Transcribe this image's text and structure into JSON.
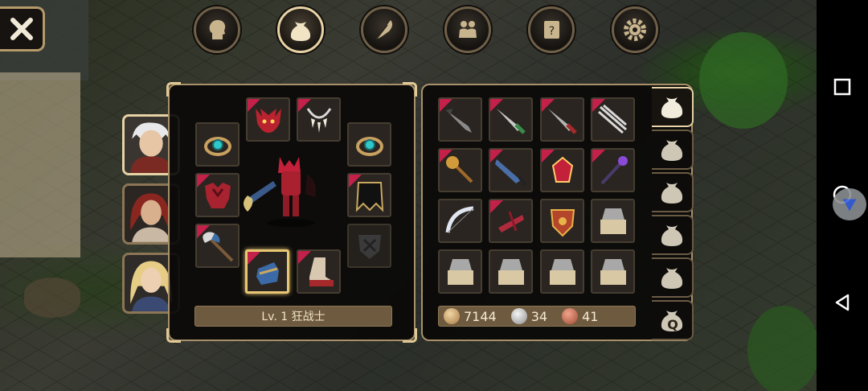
{
  "top_tabs": [
    {
      "name": "character",
      "icon": "head-icon",
      "active": false
    },
    {
      "name": "inventory",
      "icon": "bag-icon",
      "active": true
    },
    {
      "name": "skills",
      "icon": "feather-icon",
      "active": false
    },
    {
      "name": "party",
      "icon": "people-icon",
      "active": false
    },
    {
      "name": "quests",
      "icon": "scroll-icon",
      "active": false
    },
    {
      "name": "settings",
      "icon": "gear-icon",
      "active": false
    }
  ],
  "character": {
    "level_label": "Lv. 1 狂战士"
  },
  "portraits": [
    {
      "name": "white-haired-hero",
      "active": true
    },
    {
      "name": "red-haired-warrior",
      "active": false
    },
    {
      "name": "blonde-elf",
      "active": false
    }
  ],
  "equipment": [
    {
      "slot": "helmet",
      "item": "red-dragon-helm-icon",
      "new": true
    },
    {
      "slot": "necklace",
      "item": "fang-necklace-icon",
      "new": true
    },
    {
      "slot": "ring-left",
      "item": "teal-ring-icon",
      "new": false
    },
    {
      "slot": "ring-right",
      "item": "teal-ring-icon",
      "new": false
    },
    {
      "slot": "armor",
      "item": "red-dragon-armor-icon",
      "new": true
    },
    {
      "slot": "cape",
      "item": "black-cape-icon",
      "new": true
    },
    {
      "slot": "weapon",
      "item": "double-axe-icon",
      "new": true
    },
    {
      "slot": "offhand",
      "item": "shield-placeholder-icon",
      "new": false
    },
    {
      "slot": "gloves",
      "item": "blue-gauntlet-icon",
      "new": true,
      "selected": true
    },
    {
      "slot": "boots",
      "item": "red-boot-icon",
      "new": true
    }
  ],
  "inventory": [
    {
      "item": "dark-dagger-icon",
      "new": true
    },
    {
      "item": "green-sword-icon",
      "new": true
    },
    {
      "item": "red-sword-icon",
      "new": true
    },
    {
      "item": "claw-blade-icon",
      "new": true
    },
    {
      "item": "golden-mace-icon",
      "new": true
    },
    {
      "item": "blue-greatsword-icon",
      "new": true
    },
    {
      "item": "red-gem-icon",
      "new": true
    },
    {
      "item": "purple-staff-icon",
      "new": true
    },
    {
      "item": "silver-bow-icon",
      "new": true
    },
    {
      "item": "crimson-crossbow-icon",
      "new": true
    },
    {
      "item": "ornate-shield-icon",
      "new": false
    },
    {
      "item": "treasure-box-icon",
      "new": false
    },
    {
      "item": "treasure-box-icon",
      "new": false
    },
    {
      "item": "treasure-box-icon",
      "new": false
    },
    {
      "item": "treasure-box-icon",
      "new": false
    },
    {
      "item": "treasure-box-icon",
      "new": false
    }
  ],
  "currency": {
    "gold": "7144",
    "silver": "34",
    "copper": "41"
  },
  "bag_tabs": [
    {
      "label": "",
      "active": true
    },
    {
      "label": "",
      "active": false
    },
    {
      "label": "",
      "active": false
    },
    {
      "label": "",
      "active": false
    },
    {
      "label": "",
      "active": false
    },
    {
      "label": "Q",
      "active": false
    }
  ],
  "colors": {
    "frame": "#a8916a",
    "new_marker": "#c3204a",
    "selected": "#e8c774"
  }
}
